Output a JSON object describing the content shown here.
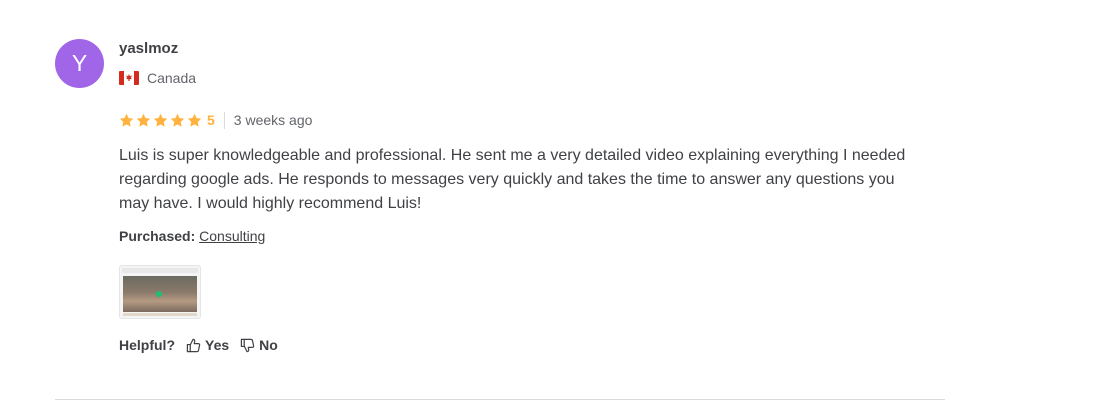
{
  "review": {
    "avatar_letter": "Y",
    "avatar_color": "#a166e8",
    "username": "yaslmoz",
    "country": "Canada",
    "rating": 5,
    "rating_label": "5",
    "time_ago": "3 weeks ago",
    "text": "Luis is super knowledgeable and professional. He sent me a very detailed video explaining everything I needed regarding google ads. He responds to messages very quickly and takes the time to answer any questions you may have. I would highly recommend Luis!",
    "purchased_label": "Purchased:",
    "purchased_item": "Consulting",
    "helpful_label": "Helpful?",
    "yes_label": "Yes",
    "no_label": "No"
  },
  "colors": {
    "star": "#ffb33e",
    "text": "#404145",
    "muted": "#62646a"
  },
  "icons": {
    "flag": "canada-flag-icon",
    "star": "star-icon",
    "thumbs_up": "thumbs-up-icon",
    "thumbs_down": "thumbs-down-icon"
  }
}
